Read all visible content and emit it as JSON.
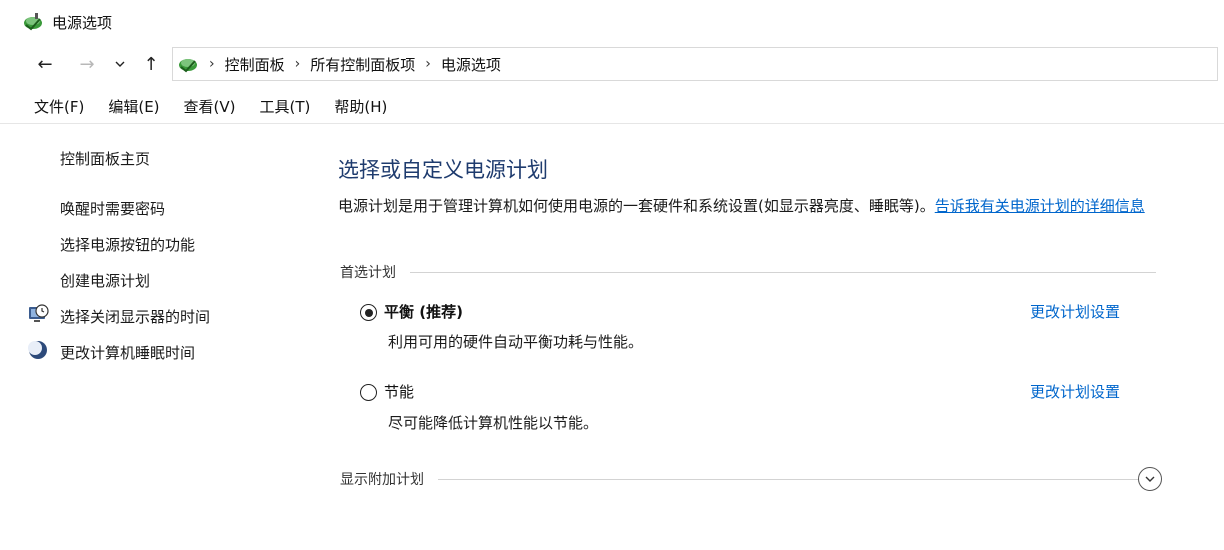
{
  "window": {
    "title": "电源选项",
    "icon": "power-options-icon"
  },
  "nav": {
    "back": "←",
    "forward": "→",
    "recent": "⌄",
    "up": "↑",
    "breadcrumbs": [
      "控制面板",
      "所有控制面板项",
      "电源选项"
    ]
  },
  "menu": {
    "items": [
      "文件(F)",
      "编辑(E)",
      "查看(V)",
      "工具(T)",
      "帮助(H)"
    ]
  },
  "sidebar": {
    "home": "控制面板主页",
    "links": [
      "唤醒时需要密码",
      "选择电源按钮的功能",
      "创建电源计划"
    ],
    "icon_links": [
      "选择关闭显示器的时间",
      "更改计算机睡眠时间"
    ]
  },
  "main": {
    "heading": "选择或自定义电源计划",
    "description": "电源计划是用于管理计算机如何使用电源的一套硬件和系统设置(如显示器亮度、睡眠等)。",
    "description_link": "告诉我有关电源计划的详细信息",
    "preferred_label": "首选计划",
    "plans": [
      {
        "name": "平衡 (推荐)",
        "desc": "利用可用的硬件自动平衡功耗与性能。",
        "link": "更改计划设置",
        "selected": true
      },
      {
        "name": "节能",
        "desc": "尽可能降低计算机性能以节能。",
        "link": "更改计划设置",
        "selected": false
      }
    ],
    "additional_label": "显示附加计划"
  },
  "colors": {
    "heading": "#1e3b6e",
    "link": "#0066cc"
  }
}
